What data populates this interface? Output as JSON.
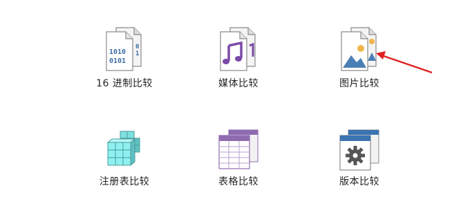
{
  "tiles": [
    {
      "label": "16 进制比较",
      "icon": "hex-compare-icon"
    },
    {
      "label": "媒体比较",
      "icon": "media-compare-icon"
    },
    {
      "label": "图片比较",
      "icon": "picture-compare-icon"
    },
    {
      "label": "注册表比较",
      "icon": "registry-compare-icon"
    },
    {
      "label": "表格比较",
      "icon": "table-compare-icon"
    },
    {
      "label": "版本比较",
      "icon": "version-compare-icon"
    }
  ],
  "annotation": {
    "icon": "red-arrow-icon",
    "color": "#e02020"
  },
  "colors": {
    "doc_border": "#8a8a8a",
    "hex_text": "#3a6ea5",
    "media_purple": "#7a4aa8",
    "picture_blue": "#4a7fb5",
    "picture_sun": "#f0b64b",
    "registry_cyan": "#7ee0e0",
    "table_purple": "#8e6bb0",
    "version_blue": "#3b73b3",
    "gear_gray": "#555555"
  }
}
